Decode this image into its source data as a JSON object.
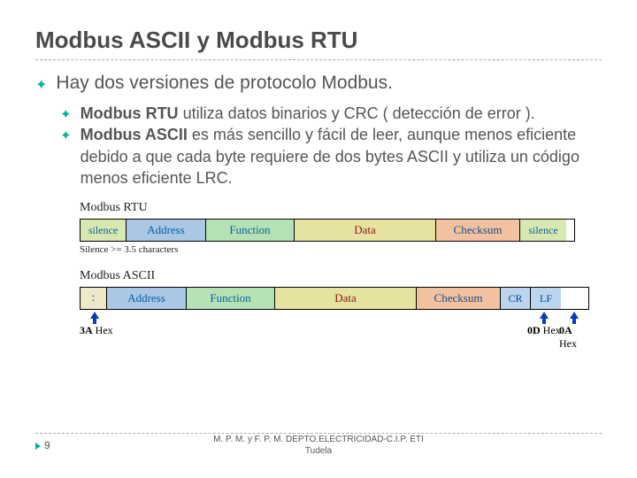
{
  "title": "Modbus ASCII y Modbus RTU",
  "intro": "Hay dos versiones de protocolo Modbus.",
  "items": [
    {
      "bold": "Modbus RTU",
      "rest": " utiliza datos binarios y CRC ( detección de error )."
    },
    {
      "bold": "Modbus ASCII",
      "rest": " es más sencillo y fácil de leer, aunque menos eficiente debido a que cada byte requiere de dos bytes ASCII y utiliza un código menos eficiente LRC."
    }
  ],
  "rtu_label": "Modbus RTU",
  "ascii_label": "Modbus ASCII",
  "fields": {
    "silence": "silence",
    "address": "Address",
    "function": "Function",
    "data": "Data",
    "checksum": "Checksum",
    "colon": ":",
    "cr": "CR",
    "lf": "LF"
  },
  "silence_note": "Silence >= 3.5 characters",
  "hex": {
    "start": "3A",
    "cr": "0D",
    "lf": "0A",
    "suffix": "Hex"
  },
  "footer": {
    "page": "9",
    "line1": "M. P. M. y F. P. M. DEPTO.ELECTRICIDAD-C.I.P. ETI",
    "line2": "Tudela"
  }
}
